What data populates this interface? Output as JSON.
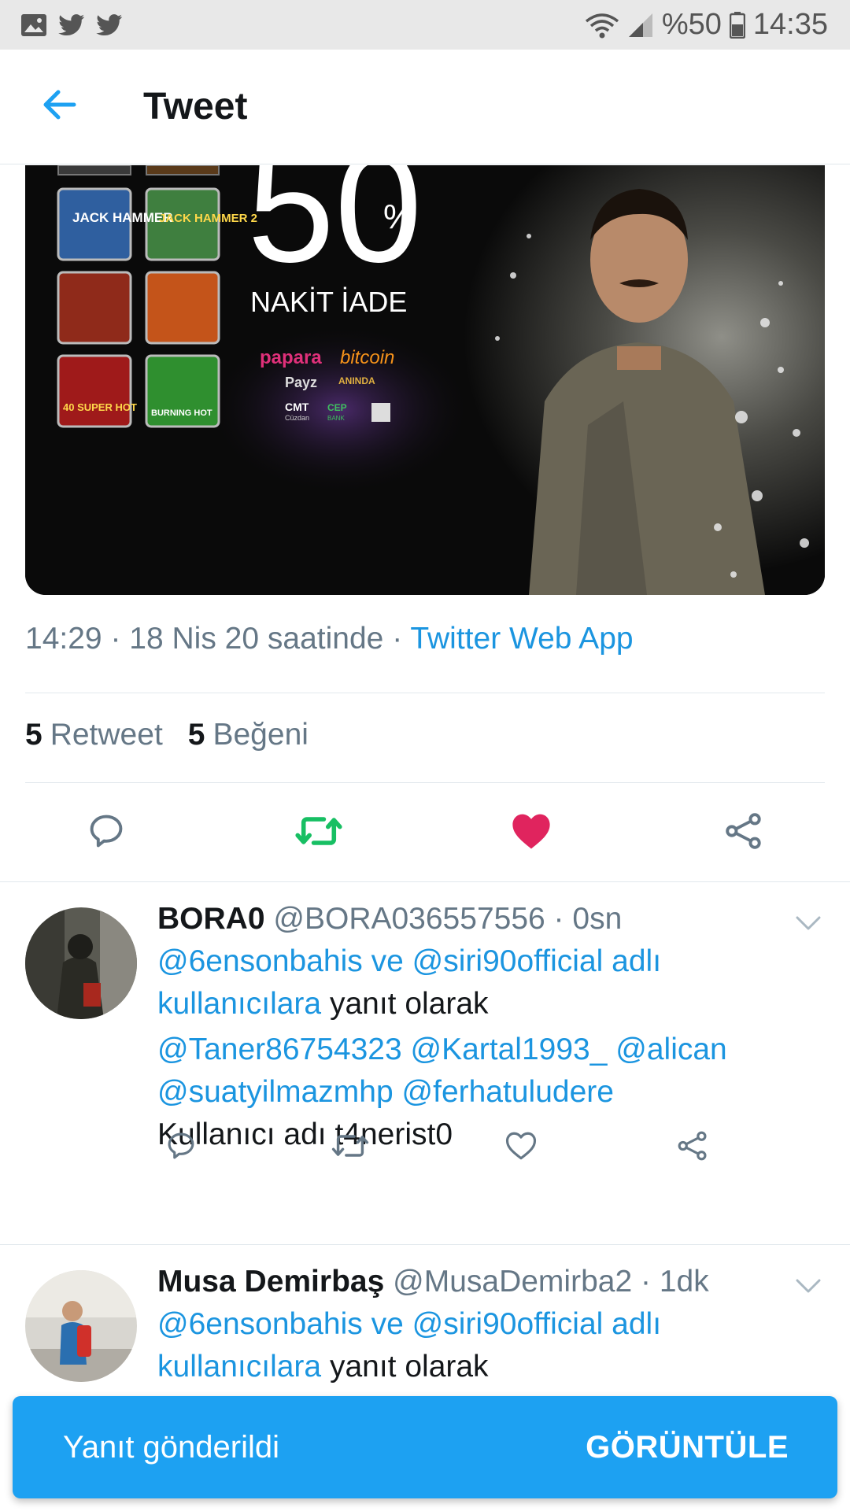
{
  "status_bar": {
    "battery_percent": "%50",
    "time": "14:35",
    "left_icons": [
      "image-icon",
      "twitter-icon",
      "twitter-icon"
    ],
    "right_icons": [
      "wifi-icon",
      "signal-icon",
      "battery-icon"
    ]
  },
  "header": {
    "title": "Tweet",
    "back_icon": "arrow-left-icon"
  },
  "media": {
    "big_number": "50",
    "percent_sign": "%",
    "headline": "NAKİT İADE",
    "payments": [
      "papara",
      "bitcoin",
      "Payz",
      "ANINDA",
      "CMT",
      "Cüzdan",
      "CEP",
      "BANK"
    ],
    "game_tiles": [
      "JACK HAMMER",
      "JACK HAMMER 2",
      "",
      "",
      "40 SUPER HOT",
      "BURNING HOT"
    ]
  },
  "tweet": {
    "time": "14:29",
    "sep": "·",
    "date": "18 Nis 20 saatinde",
    "source": "Twitter Web App",
    "retweet_count": "5",
    "retweet_label": "Retweet",
    "like_count": "5",
    "like_label": "Beğeni"
  },
  "colors": {
    "accent": "#1da1f2",
    "link": "#1b95e0",
    "retweet_green": "#17bf63",
    "like_red": "#e0245e",
    "muted": "#657786"
  },
  "replies": [
    {
      "name": "BORA0",
      "handle": "@BORA036557556",
      "sep": "·",
      "time": "0sn",
      "reply_mention_1": "@6ensonbahis",
      "reply_and": "ve",
      "reply_mention_2": "@siri90official",
      "reply_users": "adlı kullanıcılara",
      "reply_suffix": "yanıt olarak",
      "mentions_line1": "@Taner86754323 @Kartal1993_ @alican",
      "mentions_line2": "@suatyilmazmhp @ferhatuludere",
      "text": "Kullanıcı adı t4nerist0"
    },
    {
      "name": "Musa Demirbaş",
      "handle": "@MusaDemirba2",
      "sep": "·",
      "time": "1dk",
      "reply_mention_1": "@6ensonbahis",
      "reply_and": "ve",
      "reply_mention_2": "@siri90official",
      "reply_users": "adlı kullanıcılara",
      "reply_suffix": "yanıt olarak"
    }
  ],
  "snackbar": {
    "message": "Yanıt gönderildi",
    "action": "GÖRÜNTÜLE"
  }
}
